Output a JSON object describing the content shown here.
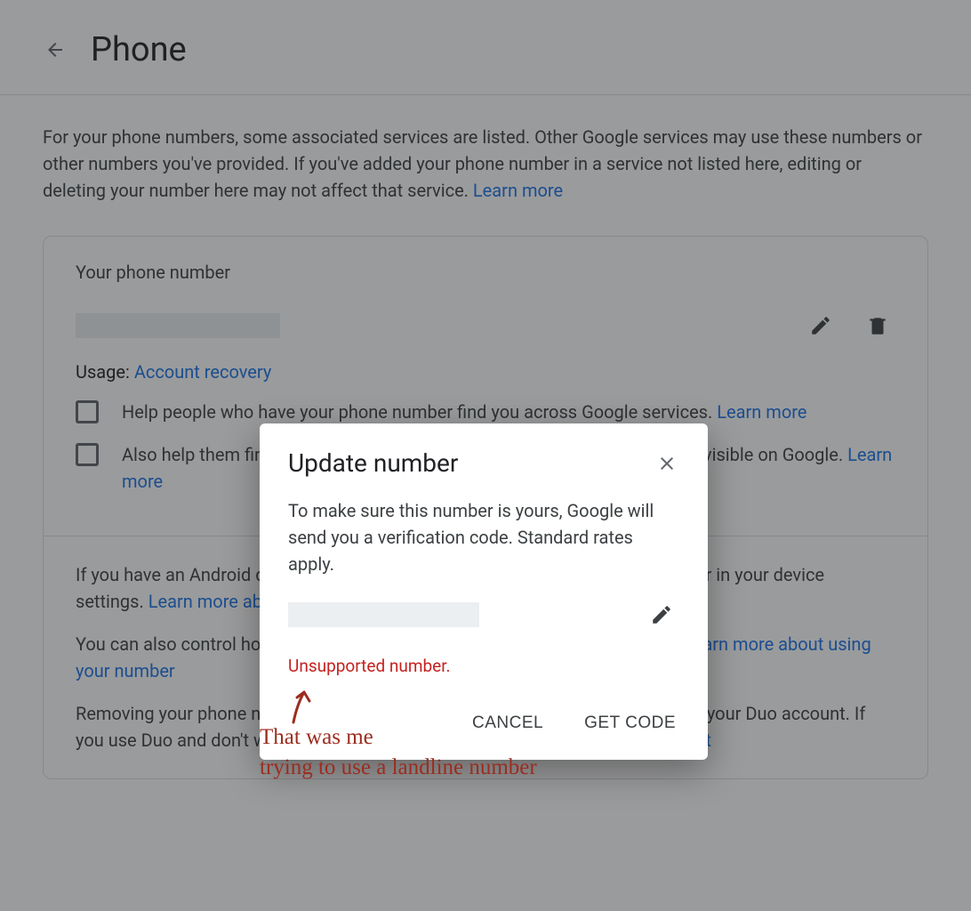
{
  "header": {
    "title": "Phone"
  },
  "intro": {
    "text": "For your phone numbers, some associated services are listed. Other Google services may use these numbers or other numbers you've provided. If you've added your phone number in a service not listed here, editing or deleting your number here may not affect that service. ",
    "learn_more": "Learn more"
  },
  "card": {
    "section_title": "Your phone number",
    "usage_label": "Usage: ",
    "usage_link": "Account recovery",
    "check1_text": "Help people who have your phone number find you across Google services. ",
    "check1_link": "Learn more",
    "check2_text": "Also help them find you in videocalling. Your phone number may be made visible on Google. ",
    "check2_link": "Learn more",
    "android_text": "If you have an Android device, you may have entered an additional phone number in your device settings. ",
    "android_link": "Learn more about number settings",
    "control_text": "You can also control how your phone number helps people connect with you. ",
    "control_link": "Learn more about using your number",
    "duo_text": "Removing your phone number from your Google account doesn't remove it from your Duo account. If you use Duo and don't want it linked to your number, ",
    "duo_link": "unregister your Duo account"
  },
  "dialog": {
    "title": "Update number",
    "body": "To make sure this number is yours, Google will send you a verification code. Standard rates apply.",
    "error": "Unsupported number.",
    "cancel": "CANCEL",
    "get_code": "GET CODE"
  },
  "annotation": {
    "text": "That was me\ntrying to use a landline number"
  }
}
